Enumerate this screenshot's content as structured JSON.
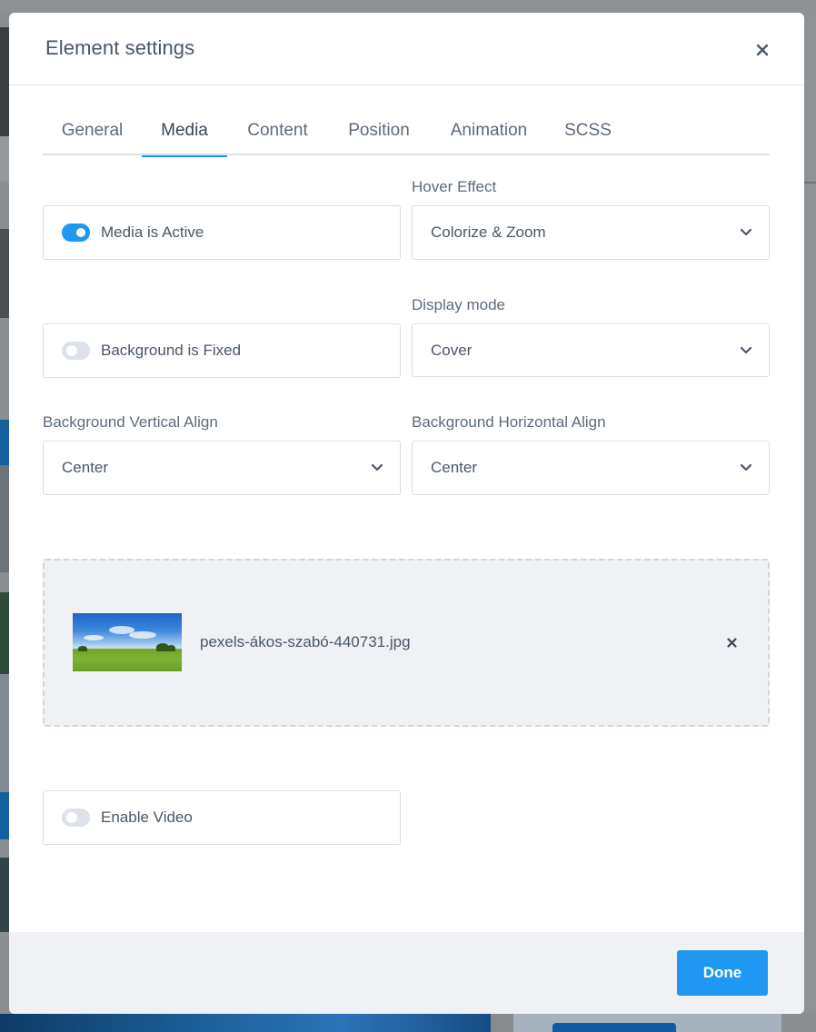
{
  "modal": {
    "title": "Element settings",
    "close_icon": "close-icon"
  },
  "tabs": [
    {
      "label": "General",
      "active": false
    },
    {
      "label": "Media",
      "active": true
    },
    {
      "label": "Content",
      "active": false
    },
    {
      "label": "Position",
      "active": false
    },
    {
      "label": "Animation",
      "active": false
    },
    {
      "label": "SCSS",
      "active": false
    }
  ],
  "media_active": {
    "label": "Media is Active",
    "checked": true
  },
  "hover_effect": {
    "label": "Hover Effect",
    "value": "Colorize & Zoom"
  },
  "background_fixed": {
    "label": "Background is Fixed",
    "checked": false
  },
  "display_mode": {
    "label": "Display mode",
    "value": "Cover"
  },
  "bg_vertical_align": {
    "label": "Background Vertical Align",
    "value": "Center"
  },
  "bg_horizontal_align": {
    "label": "Background Horizontal Align",
    "value": "Center"
  },
  "media_file": {
    "file_name": "pexels-ákos-szabó-440731.jpg",
    "remove_icon": "close-icon"
  },
  "enable_video": {
    "label": "Enable Video",
    "checked": false
  },
  "footer": {
    "done_label": "Done"
  },
  "colors": {
    "accent": "#1e98f0",
    "text": "#4a5666",
    "muted_bg": "#eff1f4"
  }
}
